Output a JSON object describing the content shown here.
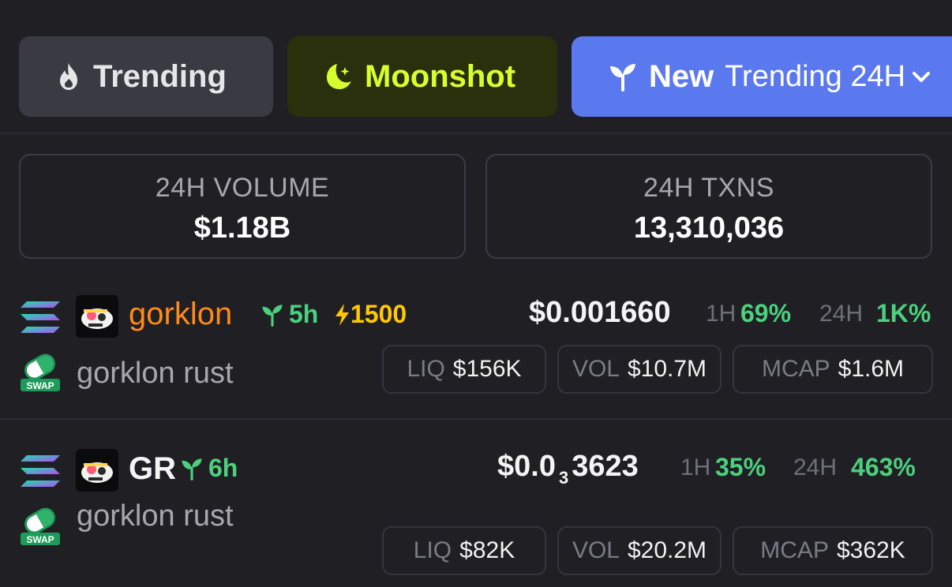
{
  "tabs": {
    "trending": {
      "label": "Trending",
      "icon": "fire-icon"
    },
    "moonshot": {
      "label": "Moonshot",
      "icon": "moon-star-icon"
    },
    "new": {
      "label": "New",
      "icon": "sprout-icon",
      "timeframe": "Trending 24H"
    }
  },
  "stats": {
    "volume": {
      "label": "24H VOLUME",
      "value": "$1.18B"
    },
    "txns": {
      "label": "24H TXNS",
      "value": "13,310,036"
    }
  },
  "tokens": [
    {
      "symbol": "gorklon",
      "name": "gorklon rust",
      "age": "5h",
      "boost": "1500",
      "price": "$0.001660",
      "change_1h_label": "1H",
      "change_1h": "69%",
      "change_24h_label": "24H",
      "change_24h": "1K%",
      "liq_label": "LIQ",
      "liq": "$156K",
      "vol_label": "VOL",
      "vol": "$10.7M",
      "mcap_label": "MCAP",
      "mcap": "$1.6M"
    },
    {
      "symbol": "GR",
      "name": "gorklon rust",
      "age": "6h",
      "price_prefix": "$0.0",
      "price_zeros": "3",
      "price_digits": "3623",
      "change_1h_label": "1H",
      "change_1h": "35%",
      "change_24h_label": "24H",
      "change_24h": "463%",
      "liq_label": "LIQ",
      "liq": "$82K",
      "vol_label": "VOL",
      "vol": "$20.2M",
      "mcap_label": "MCAP",
      "mcap": "$362K"
    }
  ],
  "badges": {
    "swap": "SWAP"
  },
  "colors": {
    "background": "#1f1f24",
    "moonshot_accent": "#d6ff2e",
    "new_tab": "#5b79ef",
    "positive": "#4cd07d",
    "boost": "#ffc800",
    "symbol_highlight": "#ff8a1a"
  }
}
